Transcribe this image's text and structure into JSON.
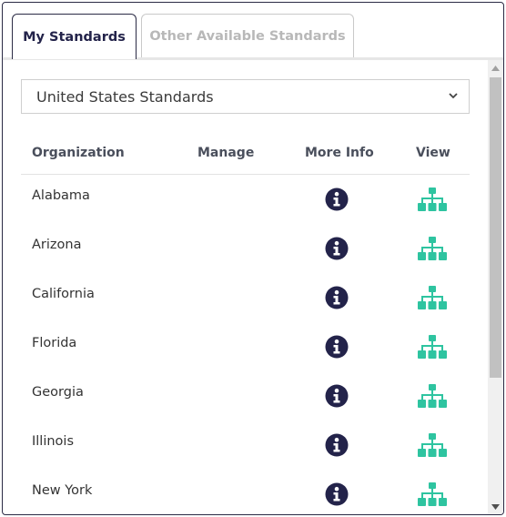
{
  "tabs": [
    {
      "label": "My Standards",
      "active": true
    },
    {
      "label": "Other Available Standards",
      "active": false
    }
  ],
  "standards_select": {
    "selected": "United States Standards"
  },
  "table": {
    "headers": {
      "organization": "Organization",
      "manage": "Manage",
      "more_info": "More Info",
      "view": "View"
    },
    "rows": [
      {
        "organization": "Alabama",
        "more_info_icon": "info-circle-icon",
        "view_icon": "hierarchy-icon"
      },
      {
        "organization": "Arizona",
        "more_info_icon": "info-circle-icon",
        "view_icon": "hierarchy-icon"
      },
      {
        "organization": "California",
        "more_info_icon": "info-circle-icon",
        "view_icon": "hierarchy-icon"
      },
      {
        "organization": "Florida",
        "more_info_icon": "info-circle-icon",
        "view_icon": "hierarchy-icon"
      },
      {
        "organization": "Georgia",
        "more_info_icon": "info-circle-icon",
        "view_icon": "hierarchy-icon"
      },
      {
        "organization": "Illinois",
        "more_info_icon": "info-circle-icon",
        "view_icon": "hierarchy-icon"
      },
      {
        "organization": "New York",
        "more_info_icon": "info-circle-icon",
        "view_icon": "hierarchy-icon"
      }
    ]
  },
  "colors": {
    "info_icon": "#23234a",
    "view_icon": "#2ec4a0",
    "active_tab_text": "#23234a",
    "inactive_tab_text": "#b8b8b8"
  }
}
